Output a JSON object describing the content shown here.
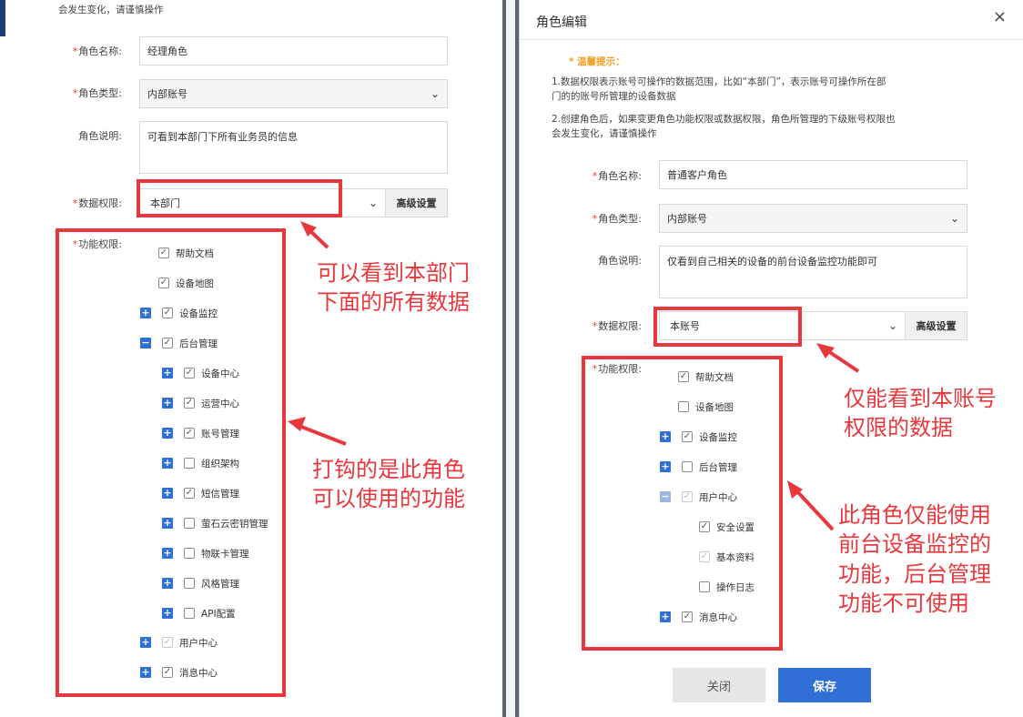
{
  "left": {
    "note_line": "会发生变化，请谨慎操作",
    "labels": {
      "role_name": "角色名称:",
      "role_type": "角色类型:",
      "role_desc": "角色说明:",
      "data_perm": "数据权限:",
      "func_perm": "功能权限:"
    },
    "role_name_value": "经理角色",
    "role_type_value": "内部账号",
    "role_desc_value": "可看到本部门下所有业务员的信息",
    "data_perm_value": "本部门",
    "advanced_label": "高级设置",
    "tree": [
      {
        "label": "帮助文档",
        "checked": true
      },
      {
        "label": "设备地图",
        "checked": true
      },
      {
        "label": "设备监控",
        "checked": true
      },
      {
        "label": "后台管理",
        "checked": true
      },
      {
        "label": "设备中心",
        "checked": true
      },
      {
        "label": "运营中心",
        "checked": true
      },
      {
        "label": "账号管理",
        "checked": true
      },
      {
        "label": "组织架构",
        "checked": false
      },
      {
        "label": "短信管理",
        "checked": true
      },
      {
        "label": "萤石云密钥管理",
        "checked": false
      },
      {
        "label": "物联卡管理",
        "checked": false
      },
      {
        "label": "风格管理",
        "checked": false
      },
      {
        "label": "API配置",
        "checked": false
      },
      {
        "label": "用户中心",
        "checked": true,
        "dim": true
      },
      {
        "label": "消息中心",
        "checked": true
      }
    ],
    "annotation_1": [
      "可以看到本部门",
      "下面的所有数据"
    ],
    "annotation_2": [
      "打钩的是此角色",
      "可以使用的功能"
    ]
  },
  "right": {
    "title": "角色编辑",
    "close_glyph": "×",
    "tip_title": "* 温馨提示：",
    "tip_lines": [
      "1.数据权限表示账号可操作的数据范围，比如“本部门”，表示账号可操作所在部",
      "门的的账号所管理的设备数据",
      "2.创建角色后，如果变更角色功能权限或数据权限，角色所管理的下级账号权限也",
      "会发生变化，请谨慎操作"
    ],
    "labels": {
      "role_name": "角色名称:",
      "role_type": "角色类型:",
      "role_desc": "角色说明:",
      "data_perm": "数据权限:",
      "func_perm": "功能权限:"
    },
    "role_name_value": "普通客户角色",
    "role_type_value": "内部账号",
    "role_desc_value": "仅看到自己相关的设备的前台设备监控功能即可",
    "data_perm_value": "本账号",
    "advanced_label": "高级设置",
    "tree": [
      {
        "label": "帮助文档",
        "checked": true
      },
      {
        "label": "设备地图",
        "checked": false
      },
      {
        "label": "设备监控",
        "checked": true
      },
      {
        "label": "后台管理",
        "checked": false
      },
      {
        "label": "用户中心",
        "checked": true,
        "dim": true
      },
      {
        "label": "安全设置",
        "checked": true
      },
      {
        "label": "基本资料",
        "checked": true,
        "dim": true
      },
      {
        "label": "操作日志",
        "checked": false
      },
      {
        "label": "消息中心",
        "checked": true
      }
    ],
    "annotation_1": [
      "仅能看到本账号",
      "权限的数据"
    ],
    "annotation_2": [
      "此角色仅能使用",
      "前台设备监控的",
      "功能，后台管理",
      "功能不可使用"
    ],
    "close_button": "关闭",
    "save_button": "保存"
  }
}
